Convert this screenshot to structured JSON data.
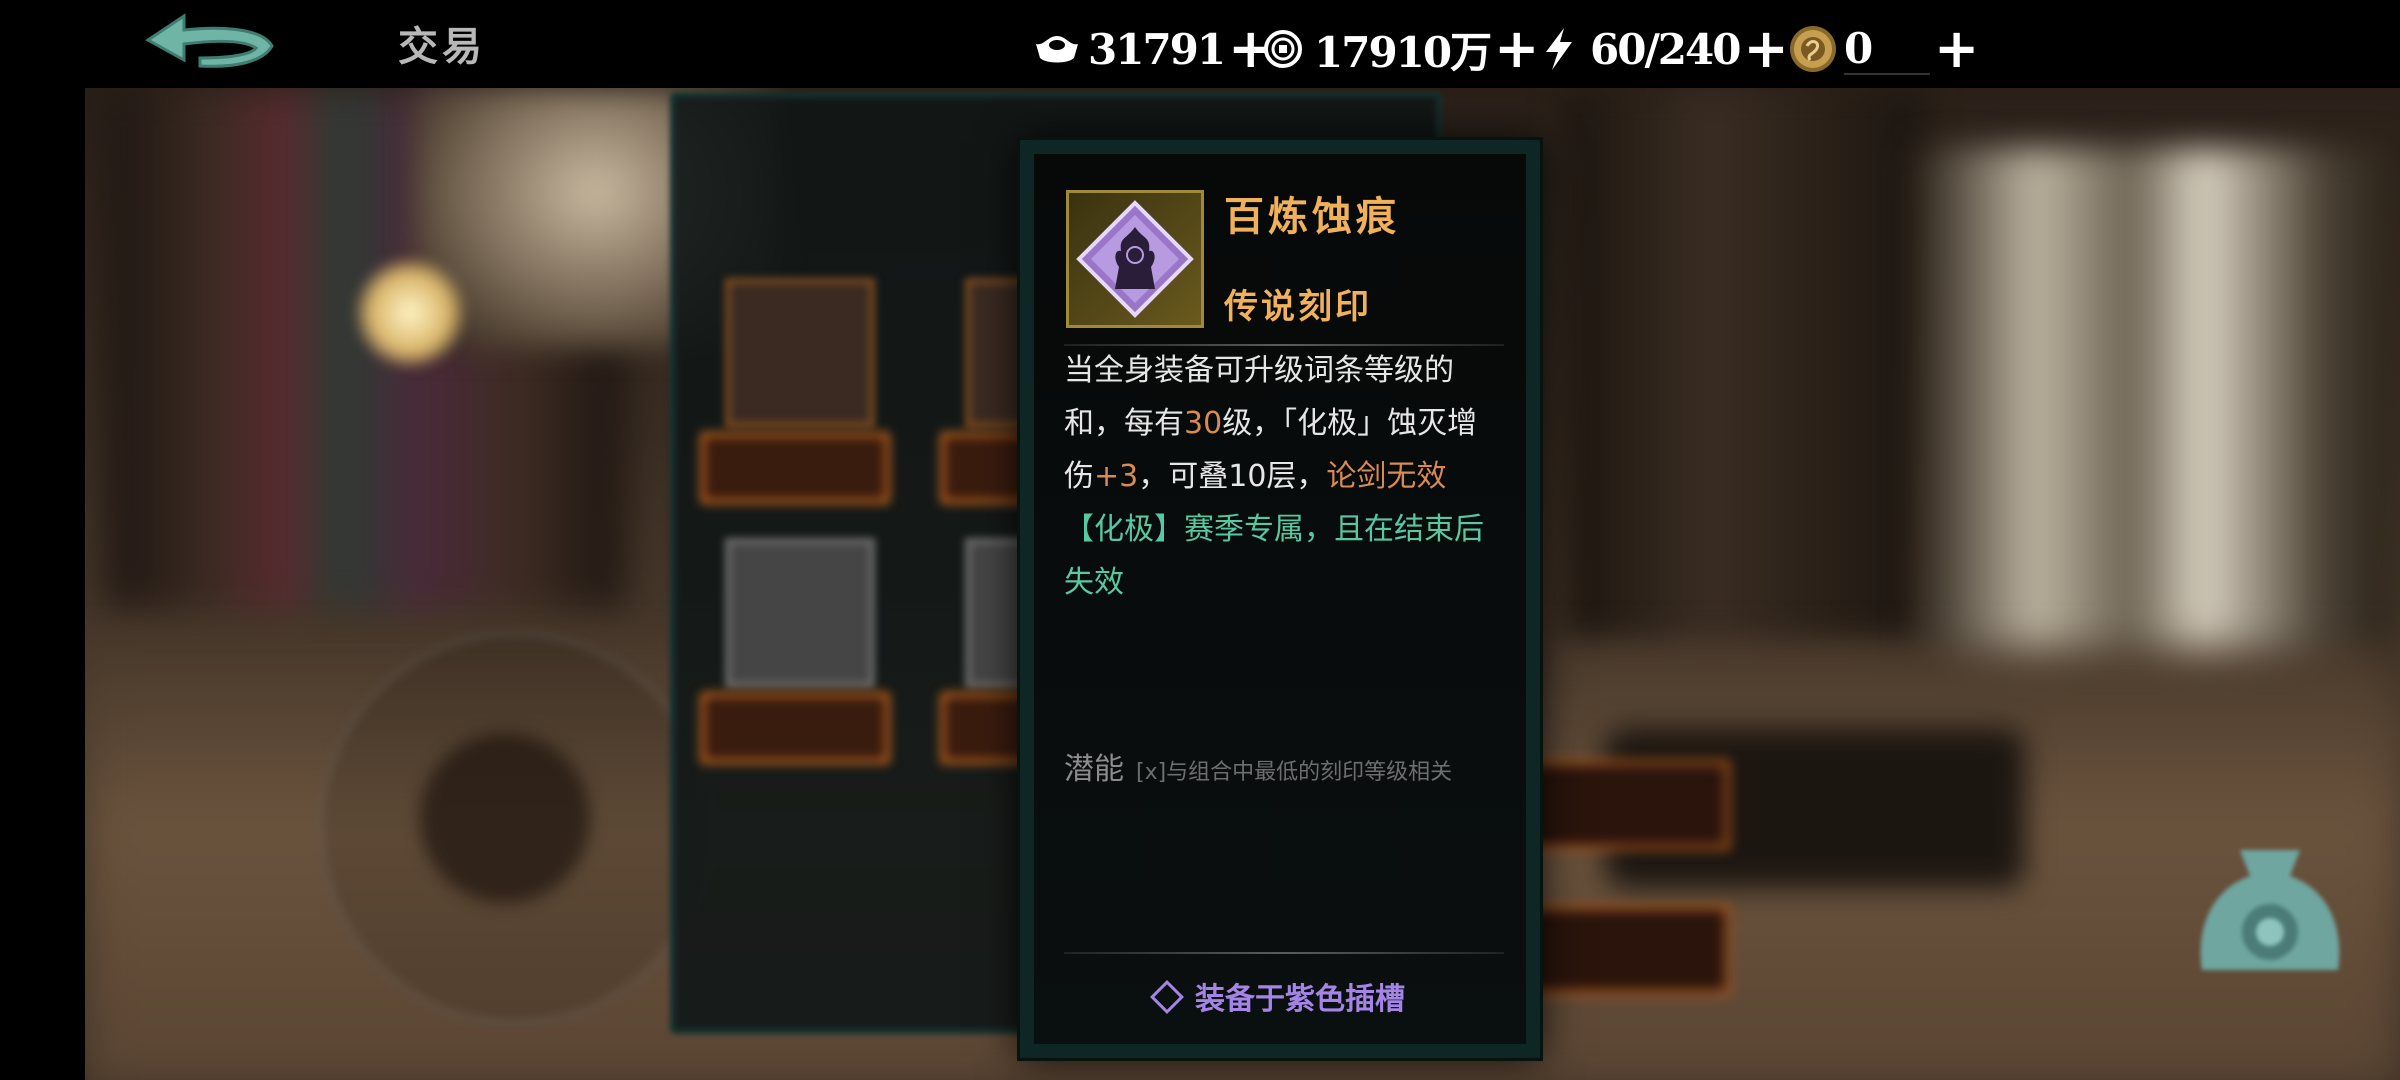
{
  "header": {
    "title": "交易",
    "resources": [
      {
        "icon": "silver-ingot-icon",
        "value": "31791",
        "plus": "+"
      },
      {
        "icon": "copper-coin-icon",
        "value": "17910万",
        "plus": "+"
      },
      {
        "icon": "lightning-stamina-icon",
        "value": "60/240",
        "plus": "+"
      },
      {
        "icon": "gold-dragon-coin-icon",
        "value": "0",
        "plus": "+"
      }
    ]
  },
  "tooltip": {
    "name": "百炼蚀痕",
    "rarity": "传说刻印",
    "desc": {
      "p1": "当全身装备可升级词条等级的和，每有",
      "n1": "30",
      "p2": "级，「化极」蚀灭增伤",
      "n2": "+3",
      "p3": "，可叠10层，",
      "o1": "论剑无效",
      "g1": "【化极】赛季专属，且在结束后失效"
    },
    "potential_label": "潜能",
    "potential_text": "[x]与组合中最低的刻印等级相关",
    "slot_info": "装备于紫色插槽"
  },
  "colors": {
    "accent_gold": "#f0b15a",
    "highlight_orange": "#d88a52",
    "highlight_green": "#58c8a0",
    "slot_purple": "#a484e6"
  }
}
